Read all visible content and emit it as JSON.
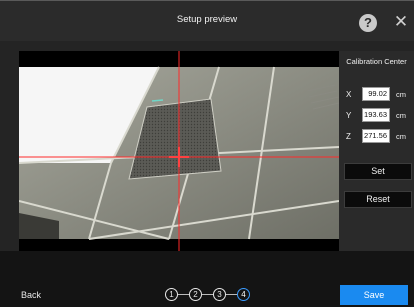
{
  "window": {
    "title": "Setup preview"
  },
  "icons": {
    "help": "question-circle-icon",
    "close": "close-icon"
  },
  "panel": {
    "title": "Calibration Center",
    "coords": [
      {
        "axis": "X",
        "value": "99.02",
        "unit": "cm"
      },
      {
        "axis": "Y",
        "value": "193.63",
        "unit": "cm"
      },
      {
        "axis": "Z",
        "value": "271.56",
        "unit": "cm"
      }
    ],
    "set_label": "Set",
    "reset_label": "Reset"
  },
  "footer": {
    "back_label": "Back",
    "steps": [
      "1",
      "2",
      "3",
      "4"
    ],
    "active_step": "4",
    "save_label": "Save"
  },
  "colors": {
    "accent": "#1a8af0",
    "crosshair": "#ff2a2a"
  }
}
